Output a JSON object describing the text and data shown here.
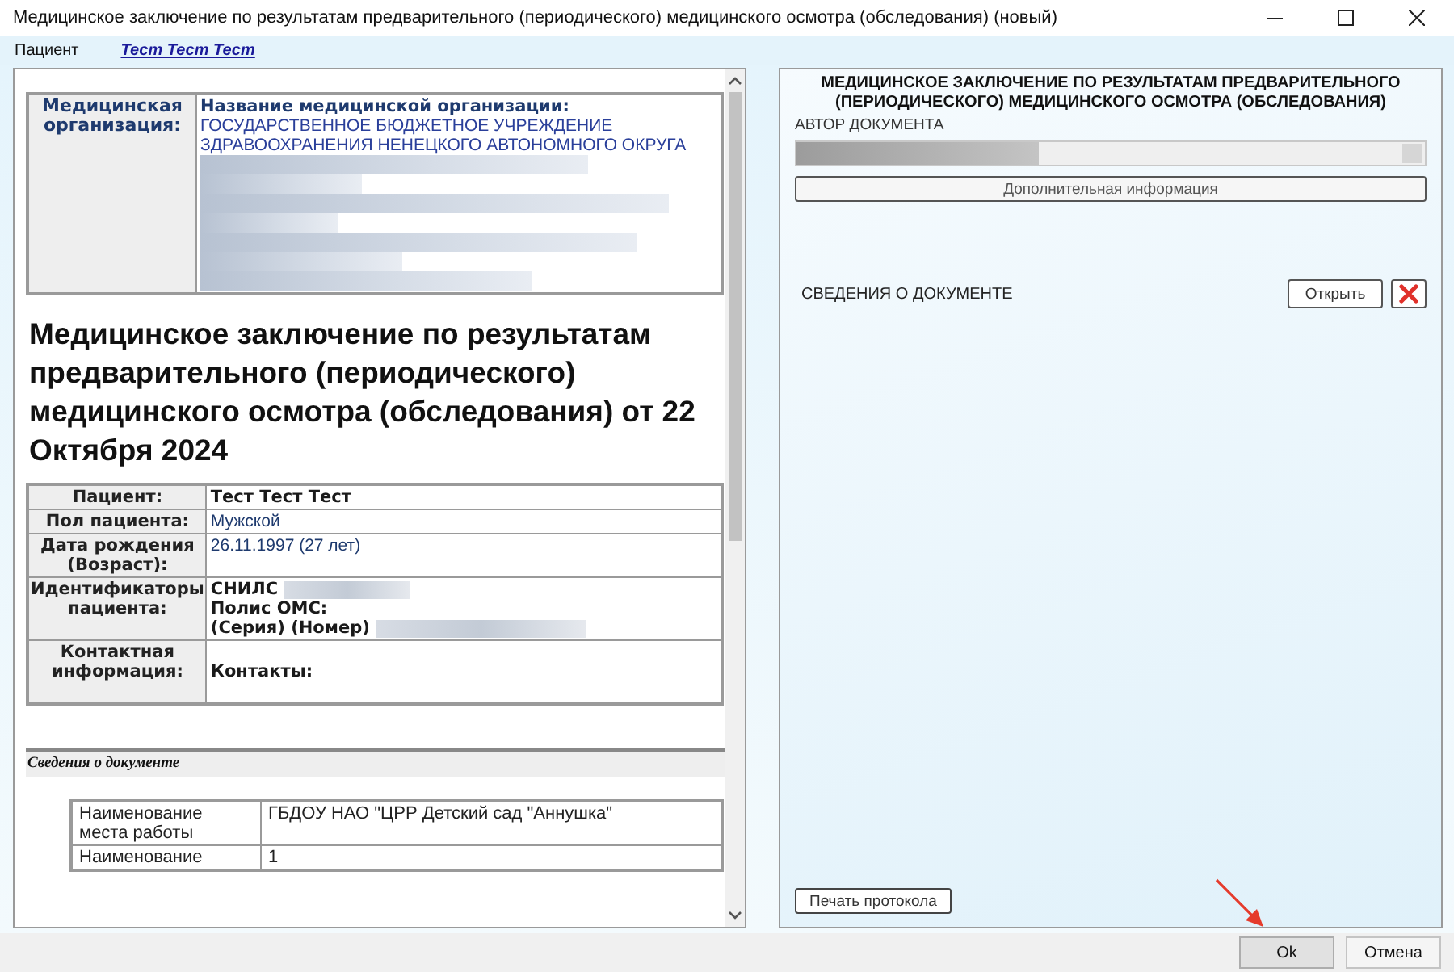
{
  "window": {
    "title": "Медицинское заключение по результатам предварительного (периодического) медицинского осмотра (обследования) (новый)"
  },
  "patient_bar": {
    "label": "Пациент",
    "name": "Тест Тест Тест"
  },
  "document": {
    "org_table": {
      "label": "Медицинская организация:",
      "heading": "Название медицинской организации:",
      "value": "ГОСУДАРСТВЕННОЕ БЮДЖЕТНОЕ УЧРЕЖДЕНИЕ ЗДРАВООХРАНЕНИЯ НЕНЕЦКОГО АВТОНОМНОГО ОКРУГА"
    },
    "title": "Медицинское заключение по результатам предварительного (периодического) медицинского осмотра (обследования) от 22 Октября 2024",
    "patient_rows": [
      {
        "kind": "bold",
        "label": "Пациент:",
        "value": "Тест Тест Тест"
      },
      {
        "kind": "plain",
        "label": "Пол пациента:",
        "value": "Мужской"
      },
      {
        "kind": "plain",
        "label": "Дата рождения (Возраст):",
        "value": "26.11.1997 (27 лет)"
      },
      {
        "kind": "ids",
        "label": "Идентификаторы пациента:",
        "lines": [
          {
            "text": "СНИЛС",
            "redacted": true
          },
          {
            "text": "Полис ОМС:",
            "redacted": false
          },
          {
            "text": "(Серия) (Номер)",
            "redacted": true
          }
        ]
      },
      {
        "kind": "contacts",
        "label": "Контактная информация:",
        "value": "Контакты:"
      }
    ],
    "section_title": "Сведения о документе",
    "doc_rows": [
      {
        "label": "Наименование места работы",
        "value": "ГБДОУ НАО \"ЦРР Детский сад \"Аннушка\""
      },
      {
        "label": "Наименование",
        "value": "1"
      }
    ]
  },
  "panel": {
    "title": "МЕДИЦИНСКОЕ ЗАКЛЮЧЕНИЕ ПО РЕЗУЛЬТАТАМ ПРЕДВАРИТЕЛЬНОГО (ПЕРИОДИЧЕСКОГО) МЕДИЦИНСКОГО ОСМОТРА (ОБСЛЕДОВАНИЯ)",
    "author_label": "АВТОР ДОКУМЕНТА",
    "more_button": "Дополнительная информация",
    "doc_info_label": "СВЕДЕНИЯ О ДОКУМЕНТЕ",
    "open_button": "Открыть",
    "print_button": "Печать протокола"
  },
  "buttons": [
    {
      "label": "Ok",
      "default": true
    },
    {
      "label": "Отмена",
      "default": false
    }
  ]
}
